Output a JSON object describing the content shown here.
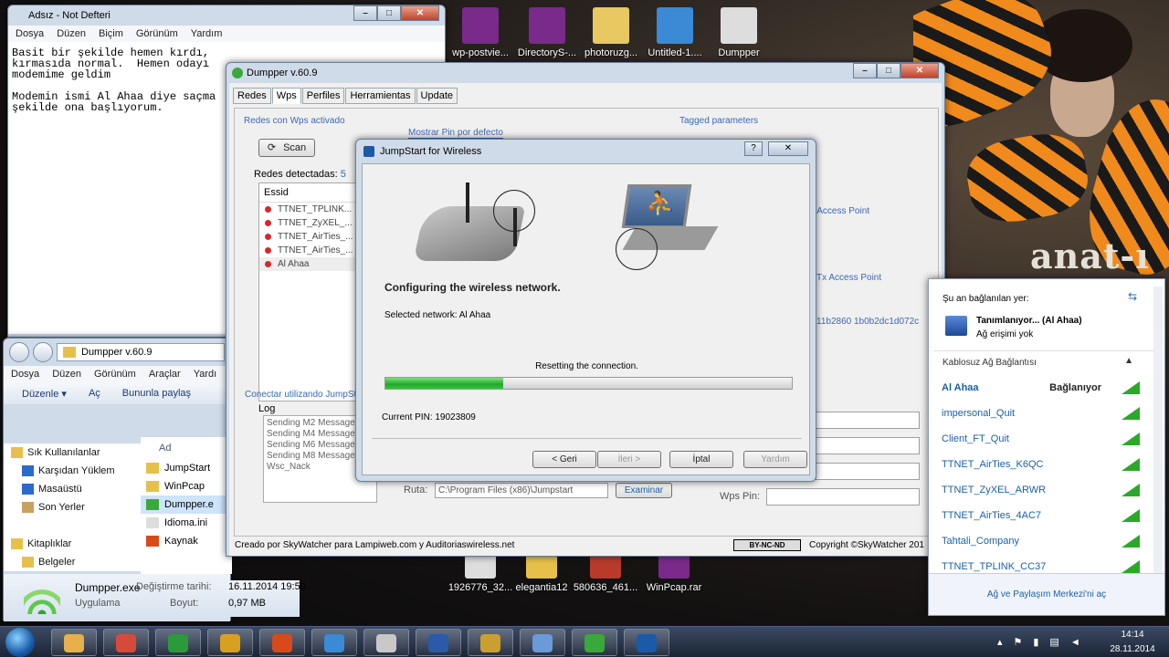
{
  "desktop_icons": [
    {
      "label": "wp-postvie...",
      "color": "#7a2a8a"
    },
    {
      "label": "DirectoryS-...",
      "color": "#7a2a8a"
    },
    {
      "label": "photoruzg...",
      "color": "#e8c860"
    },
    {
      "label": "Untitled-1....",
      "color": "#3a8ad6"
    },
    {
      "label": "Dumpper",
      "color": "#dddddd"
    }
  ],
  "bottom_icons": [
    "1926776_32...",
    "elegantia12",
    "580636_461...",
    "WinPcap.rar"
  ],
  "brand_text": "anat-ı",
  "notepad": {
    "title": "Adsız - Not Defteri",
    "menu": [
      "Dosya",
      "Düzen",
      "Biçim",
      "Görünüm",
      "Yardım"
    ],
    "text": "Basit bir şekilde hemen kırdı,\nkırmasıda normal.  Hemen odayı\nmodemime geldim\n\nModemin ismi Al Ahaa diye saçma\nşekilde ona başlıyorum."
  },
  "explorer": {
    "path": "Dumpper v.60.9",
    "menu": [
      "Dosya",
      "Düzen",
      "Görünüm",
      "Araçlar",
      "Yardı"
    ],
    "toolbar": [
      "Düzenle ▾",
      "Aç",
      "Bununla paylaş"
    ],
    "left_items": [
      "Sık Kullanılanlar",
      "Karşıdan Yüklem",
      "Masaüstü",
      "Son Yerler",
      "",
      "Kitaplıklar",
      "Belgeler"
    ],
    "col_name": "Ad",
    "files": [
      "JumpStart",
      "WinPcap",
      "Dumpper.e",
      "Idioma.ini",
      "Kaynak"
    ],
    "details": {
      "name": "Dumpper.exe",
      "type": "Uygulama",
      "mod_label": "Değiştirme tarihi:",
      "mod_value": "16.11.2014 19:50",
      "size_label": "Boyut:",
      "size_value": "0,97 MB"
    }
  },
  "dumpper": {
    "title": "Dumpper v.60.9",
    "tabs": [
      "Redes",
      "Wps",
      "Perfiles",
      "Herramientas",
      "Update"
    ],
    "grp_wps": "Redes con Wps activado",
    "show_pin": "Mostrar Pin por defecto",
    "tagged": "Tagged parameters",
    "scan": "Scan",
    "detected_label": "Redes detectadas:",
    "detected_count": "5",
    "col_essid": "Essid",
    "networks": [
      "TTNET_TPLINK...",
      "TTNET_ZyXEL_...",
      "TTNET_AirTies_...",
      "TTNET_AirTies_...",
      "Al Ahaa"
    ],
    "side1": "s Access Point",
    "side2": "Tx Access Point",
    "side3": "11b2860 1b0b2dc1d072c",
    "grp_connect": "Conectar utilizando JumpSt",
    "log_label": "Log",
    "log": [
      "Sending M2 Message",
      "Sending M4 Message",
      "Sending M6 Message",
      "Sending M8 Message",
      "Wsc_Nack"
    ],
    "ruta_label": "Ruta:",
    "ruta_value": "C:\\Program Files (x86)\\Jumpstart",
    "examinar": "Examinar",
    "wps_pin_label": "Wps Pin:",
    "footer": "Creado por SkyWatcher para Lampiweb.com y Auditoriaswireless.net",
    "license": "BY-NC-ND",
    "copyright": "Copyright ©SkyWatcher 201"
  },
  "jumpstart": {
    "title": "JumpStart for Wireless",
    "heading": "Configuring the wireless network.",
    "selected": "Selected network: Al Ahaa",
    "status": "Resetting the connection.",
    "progress": 0.29,
    "pin": "Current PIN: 19023809",
    "buttons": [
      "< Geri",
      "İleri >",
      "İptal",
      "Yardım"
    ]
  },
  "wifi": {
    "connected_to": "Şu an bağlanılan yer:",
    "conn_name": "Tanımlanıyor... (Al Ahaa)",
    "conn_status": "Ağ erişimi yok",
    "section": "Kablosuz Ağ Bağlantısı",
    "status_connecting": "Bağlanıyor",
    "networks": [
      "Al Ahaa",
      "impersonal_Quit",
      "Client_FT_Quit",
      "TTNET_AirTies_K6QC",
      "TTNET_ZyXEL_ARWR",
      "TTNET_AirTies_4AC7",
      "Tahtali_Company",
      "TTNET_TPLINK_CC37"
    ],
    "footer": "Ağ ve Paylaşım Merkezi'ni aç"
  },
  "clock": {
    "time": "14:14",
    "date": "28.11.2014"
  },
  "taskbar_colors": [
    "#e8b04a",
    "#d64a3a",
    "#2a9a3a",
    "#d8a020",
    "#d84a1a",
    "#3a8ad6",
    "#c8c8c8",
    "#2a5aa8",
    "#c9a030",
    "#6a9ad8",
    "#3aa83a",
    "#1a5aa8"
  ]
}
